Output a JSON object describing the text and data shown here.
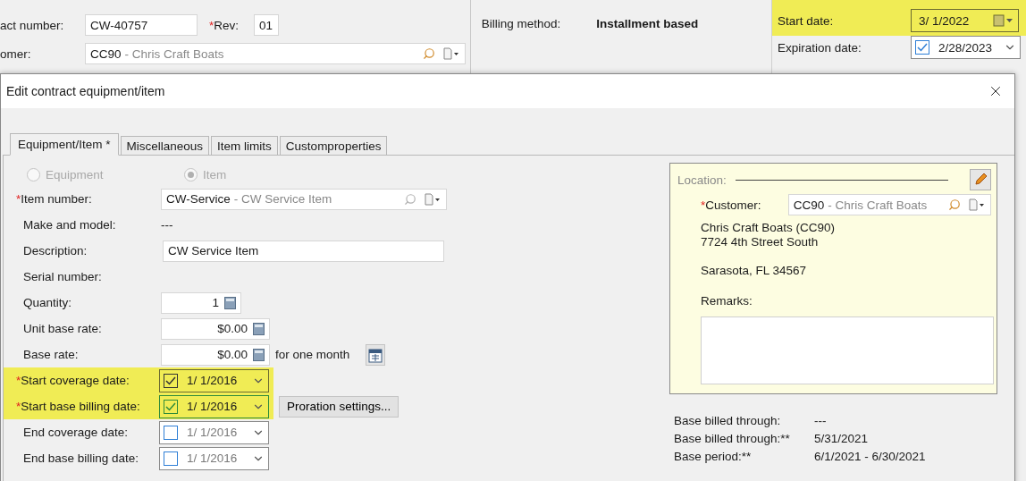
{
  "main_form": {
    "contract_number": {
      "label": "act number:",
      "value": "CW-40757"
    },
    "rev": {
      "label": "Rev:",
      "required_mark": "*",
      "value": "01"
    },
    "customer": {
      "label": "omer:",
      "code": "CC90",
      "name": "- Chris Craft Boats"
    },
    "billing_method": {
      "label": "Billing method:",
      "value": "Installment based"
    },
    "start_date": {
      "label": "Start date:",
      "value": "3/ 1/2022",
      "highlighted": true
    },
    "expiration_date": {
      "label": "Expiration date:",
      "value": "2/28/2023",
      "checked": true
    }
  },
  "dialog": {
    "title": "Edit contract equipment/item",
    "tabs": [
      {
        "label": "Equipment/Item *",
        "selected": true
      },
      {
        "label": "Miscellaneous",
        "selected": false
      },
      {
        "label": "Item limits",
        "selected": false
      },
      {
        "label": "Customproperties",
        "selected": false
      }
    ],
    "type_options": [
      {
        "label": "Equipment",
        "selected": false,
        "disabled": true
      },
      {
        "label": "Item",
        "selected": true,
        "disabled": true
      }
    ],
    "fields": [
      {
        "kind": "lookup",
        "label": "Item number:",
        "required_mark": "*",
        "highlighted": false,
        "code": "CW-Service",
        "name": "- CW Service Item"
      },
      {
        "kind": "static",
        "label": "Make and model:",
        "highlighted": false,
        "value": "---"
      },
      {
        "kind": "text",
        "label": "Description:",
        "highlighted": false,
        "value": "CW Service Item"
      },
      {
        "kind": "static",
        "label": "Serial number:",
        "highlighted": false
      },
      {
        "kind": "number",
        "label": "Quantity:",
        "highlighted": false,
        "value": "1"
      },
      {
        "kind": "number",
        "label": "Unit base rate:",
        "highlighted": false,
        "value": "$0.00"
      },
      {
        "kind": "number",
        "label": "Base rate:",
        "highlighted": false,
        "value": "$0.00",
        "suffix": "for one month"
      },
      {
        "kind": "date",
        "label": "Start coverage date:",
        "required_mark": "*",
        "highlighted": true,
        "checked": true,
        "focused": false,
        "value": "1/ 1/2016"
      },
      {
        "kind": "date",
        "label": "Start base billing date:",
        "required_mark": "*",
        "highlighted": true,
        "checked": true,
        "focused": true,
        "value": "1/ 1/2016",
        "button": "Proration settings..."
      },
      {
        "kind": "date",
        "label": "End coverage date:",
        "highlighted": false,
        "checked": false,
        "focused": false,
        "value": "1/ 1/2016"
      },
      {
        "kind": "date",
        "label": "End base billing date:",
        "highlighted": false,
        "checked": false,
        "focused": false,
        "value": "1/ 1/2016"
      }
    ],
    "location": {
      "legend": "Location:",
      "customer": {
        "label": "Customer:",
        "required_mark": "*",
        "code": "CC90",
        "name": "- Chris Craft Boats"
      },
      "address_blocks": [
        [
          "Chris Craft Boats (CC90)",
          "7724 4th Street South"
        ],
        [
          "Sarasota, FL 34567"
        ]
      ],
      "remarks_label": "Remarks:"
    },
    "summary": [
      {
        "label": "Base billed through:",
        "value": "---"
      },
      {
        "label": "Base billed through:**",
        "value": "5/31/2021"
      },
      {
        "label": "Base period:**",
        "value": "6/1/2021 - 6/30/2021"
      }
    ]
  }
}
